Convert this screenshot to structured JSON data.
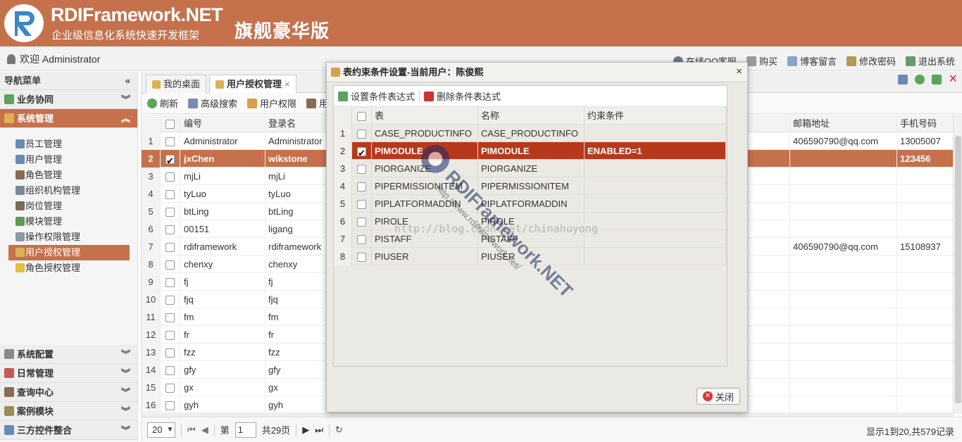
{
  "header": {
    "brand": "RDIFramework.NET",
    "tagline": "企业级信息化系统快速开发框架",
    "edition": "旗舰豪华版",
    "accent_color": "#c4714c"
  },
  "userbar": {
    "welcome": "欢迎 Administrator",
    "links": [
      {
        "label": "在线QQ客服",
        "icon": "qq-icon"
      },
      {
        "label": "购买",
        "icon": "cart-icon"
      },
      {
        "label": "博客留言",
        "icon": "blog-icon"
      },
      {
        "label": "修改密码",
        "icon": "key-icon"
      },
      {
        "label": "退出系统",
        "icon": "exit-icon"
      }
    ]
  },
  "sidebar": {
    "title": "导航菜单",
    "collapse_glyph": "«",
    "groups_top": [
      {
        "label": "业务协同",
        "icon": "checkmark-icon",
        "chevron": "︾"
      },
      {
        "label": "系统管理",
        "icon": "shield-icon",
        "chevron": "︽"
      }
    ],
    "items": [
      {
        "label": "员工管理",
        "icon": "staff-icon",
        "color": "#6a8ab5"
      },
      {
        "label": "用户管理",
        "icon": "user-icon",
        "color": "#6a8ab5"
      },
      {
        "label": "角色管理",
        "icon": "role-icon",
        "color": "#8a6a55"
      },
      {
        "label": "组织机构管理",
        "icon": "org-icon",
        "color": "#7a8a95"
      },
      {
        "label": "岗位管理",
        "icon": "post-icon",
        "color": "#7a6a55"
      },
      {
        "label": "模块管理",
        "icon": "module-icon",
        "color": "#5a9a55"
      },
      {
        "label": "操作权限管理",
        "icon": "permission-icon",
        "color": "#8a9aa5"
      },
      {
        "label": "用户授权管理",
        "icon": "user-auth-icon",
        "color": "#d7b25a"
      },
      {
        "label": "角色授权管理",
        "icon": "role-auth-icon",
        "color": "#e0c040"
      }
    ],
    "selected_index": 7,
    "groups_bottom": [
      {
        "label": "系统配置",
        "icon": "wrench-icon"
      },
      {
        "label": "日常管理",
        "icon": "calendar-icon"
      },
      {
        "label": "查询中心",
        "icon": "query-icon"
      },
      {
        "label": "案例模块",
        "icon": "case-icon"
      },
      {
        "label": "三方控件整合",
        "icon": "plugin-icon"
      }
    ],
    "bottom_chevron": "︾"
  },
  "tabs": [
    {
      "label": "我的桌面",
      "icon": "desktop-icon",
      "active": false
    },
    {
      "label": "用户授权管理",
      "icon": "user-auth-icon",
      "active": true,
      "close": "×"
    }
  ],
  "toolbar": [
    {
      "label": "刷新",
      "icon": "refresh-icon"
    },
    {
      "label": "高级搜索",
      "icon": "search-icon"
    },
    {
      "label": "用户权限",
      "icon": "key-icon"
    },
    {
      "label": "用户",
      "icon": "user-icon"
    }
  ],
  "grid": {
    "columns": {
      "id": "编号",
      "login": "登录名",
      "mail": "邮箱地址",
      "phone": "手机号码"
    },
    "rows": [
      {
        "no": "1",
        "id": "Administrator",
        "login": "Administrator",
        "mail": "406590790@qq.com",
        "phone": "13005007",
        "checked": false
      },
      {
        "no": "2",
        "id": "jxChen",
        "login": "wikstone",
        "mail": "",
        "phone": "123456",
        "checked": true
      },
      {
        "no": "3",
        "id": "mjLi",
        "login": "mjLi",
        "mail": "",
        "phone": "",
        "checked": false
      },
      {
        "no": "4",
        "id": "tyLuo",
        "login": "tyLuo",
        "mail": "",
        "phone": "",
        "checked": false
      },
      {
        "no": "5",
        "id": "btLing",
        "login": "btLing",
        "mail": "",
        "phone": "",
        "checked": false
      },
      {
        "no": "6",
        "id": "00151",
        "login": "ligang",
        "mail": "",
        "phone": "",
        "checked": false
      },
      {
        "no": "7",
        "id": "rdiframework",
        "login": "rdiframework",
        "mail": "406590790@qq.com",
        "phone": "15108937",
        "checked": false
      },
      {
        "no": "8",
        "id": "chenxy",
        "login": "chenxy",
        "mail": "",
        "phone": "",
        "checked": false
      },
      {
        "no": "9",
        "id": "fj",
        "login": "fj",
        "mail": "",
        "phone": "",
        "checked": false
      },
      {
        "no": "10",
        "id": "fjq",
        "login": "fjq",
        "mail": "",
        "phone": "",
        "checked": false
      },
      {
        "no": "11",
        "id": "fm",
        "login": "fm",
        "mail": "",
        "phone": "",
        "checked": false
      },
      {
        "no": "12",
        "id": "fr",
        "login": "fr",
        "mail": "",
        "phone": "",
        "checked": false
      },
      {
        "no": "13",
        "id": "fzz",
        "login": "fzz",
        "mail": "",
        "phone": "",
        "checked": false
      },
      {
        "no": "14",
        "id": "gfy",
        "login": "gfy",
        "mail": "",
        "phone": "",
        "checked": false
      },
      {
        "no": "15",
        "id": "gx",
        "login": "gx",
        "mail": "",
        "phone": "",
        "checked": false
      },
      {
        "no": "16",
        "id": "gyh",
        "login": "gyh",
        "mail": "",
        "phone": "",
        "checked": false
      }
    ]
  },
  "pager": {
    "page_size": "20",
    "page_label_pre": "第",
    "page_value": "1",
    "page_label_post": "共29页",
    "info": "显示1到20,共579记录"
  },
  "dialog": {
    "title": "表约束条件设置-当前用户：陈俊熙",
    "close_glyph": "×",
    "tools": [
      {
        "label": "设置条件表达式",
        "icon": "add-expression-icon"
      },
      {
        "label": "删除条件表达式",
        "icon": "delete-expression-icon"
      }
    ],
    "columns": {
      "table": "表",
      "name": "名称",
      "condition": "约束条件"
    },
    "rows": [
      {
        "no": "1",
        "table": "CASE_PRODUCTINFO",
        "name": "CASE_PRODUCTINFO",
        "condition": "",
        "checked": false
      },
      {
        "no": "2",
        "table": "PIMODULE",
        "name": "PIMODULE",
        "condition": "ENABLED=1",
        "checked": true
      },
      {
        "no": "3",
        "table": "PIORGANIZE",
        "name": "PIORGANIZE",
        "condition": "",
        "checked": false
      },
      {
        "no": "4",
        "table": "PIPERMISSIONITEM",
        "name": "PIPERMISSIONITEM",
        "condition": "",
        "checked": false
      },
      {
        "no": "5",
        "table": "PIPLATFORMADDIN",
        "name": "PIPLATFORMADDIN",
        "condition": "",
        "checked": false
      },
      {
        "no": "6",
        "table": "PIROLE",
        "name": "PIROLE",
        "condition": "",
        "checked": false
      },
      {
        "no": "7",
        "table": "PISTAFF",
        "name": "PISTAFF",
        "condition": "",
        "checked": false
      },
      {
        "no": "8",
        "table": "PIUSER",
        "name": "PIUSER",
        "condition": "",
        "checked": false
      }
    ],
    "close_button": "关闭"
  },
  "watermark": {
    "title": "RDIFramework.NET",
    "url": "http://www.rdiframework.net/",
    "blog": "http://blog.csdn.net/chinahuyong"
  }
}
